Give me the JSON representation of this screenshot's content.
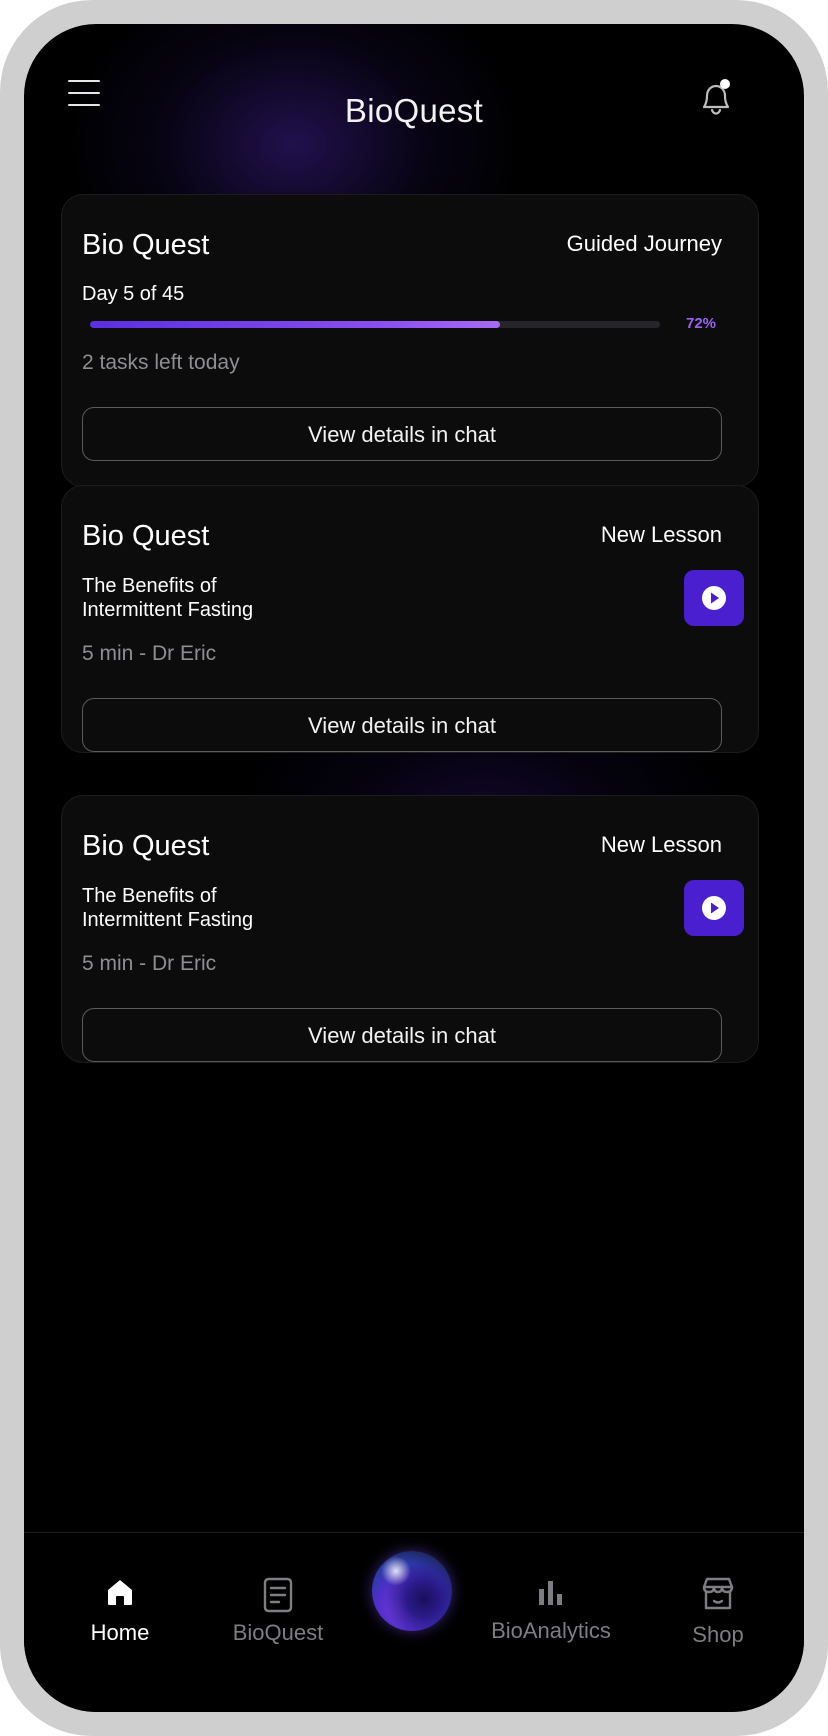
{
  "header": {
    "title": "BioQuest",
    "menu_icon": "hamburger-menu-icon",
    "notification_icon": "bell-icon"
  },
  "cards": [
    {
      "title": "Bio Quest",
      "tag": "Guided Journey",
      "day_label": "Day 5 of 45",
      "progress_percent": 72,
      "progress_label": "72%",
      "tasks_left": "2 tasks left today",
      "button_label": "View details in chat"
    },
    {
      "title": "Bio Quest",
      "tag": "New Lesson",
      "lesson_line1": "The Benefits of",
      "lesson_line2": "Intermittent Fasting",
      "meta": "5 min - Dr Eric",
      "button_label": "View details in chat",
      "play_icon": "play-icon"
    },
    {
      "title": "Bio Quest",
      "tag": "New Lesson",
      "lesson_line1": "The Benefits of",
      "lesson_line2": "Intermittent Fasting",
      "meta": "5 min - Dr Eric",
      "button_label": "View details in chat",
      "play_icon": "play-icon"
    }
  ],
  "bottom_nav": {
    "items": [
      {
        "label": "Home",
        "icon": "home-icon",
        "active": true
      },
      {
        "label": "BioQuest",
        "icon": "document-icon",
        "active": false
      },
      {
        "label": "",
        "icon": "assistant-orb-icon",
        "active": false
      },
      {
        "label": "BioAnalytics",
        "icon": "bar-chart-icon",
        "active": false
      },
      {
        "label": "Shop",
        "icon": "store-icon",
        "active": false
      }
    ]
  },
  "colors": {
    "accent": "#4a1fd0",
    "progress_text": "#9a62f2",
    "background": "#000000",
    "card_background": "#0c0c0d"
  }
}
